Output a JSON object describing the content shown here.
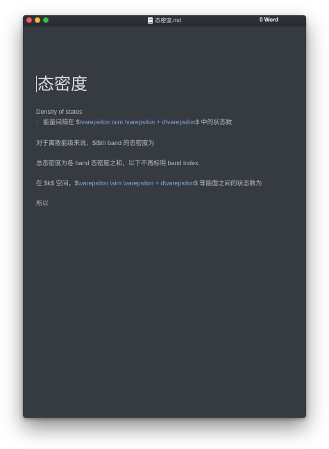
{
  "window": {
    "filename": "态密度.md",
    "word_count": "0 Word"
  },
  "doc": {
    "heading": "态密度",
    "def_term": "Density of states",
    "def_colon": ":",
    "def_pre": "能量间隔在 $",
    "def_math": "\\varepsilon \\sim \\varepsilon + d\\varepsilon",
    "def_post": "$ 中的状态数",
    "p1": "对于离散能级来说，$i$th band 的态密度为",
    "p2": "总态密度为各 band 态密度之和，以下不再标明 band index.",
    "p3_pre": "在 $k$ 空间，$",
    "p3_math": "\\varepsilon \\sim \\varepsilon + d\\varepsilon",
    "p3_post": "$ 等能面之间的状态数为",
    "p4": "所以"
  },
  "colors": {
    "background": "#363b41",
    "text": "#b4b9bf",
    "math": "#7fa7d8",
    "heading": "#dcdfe3"
  }
}
